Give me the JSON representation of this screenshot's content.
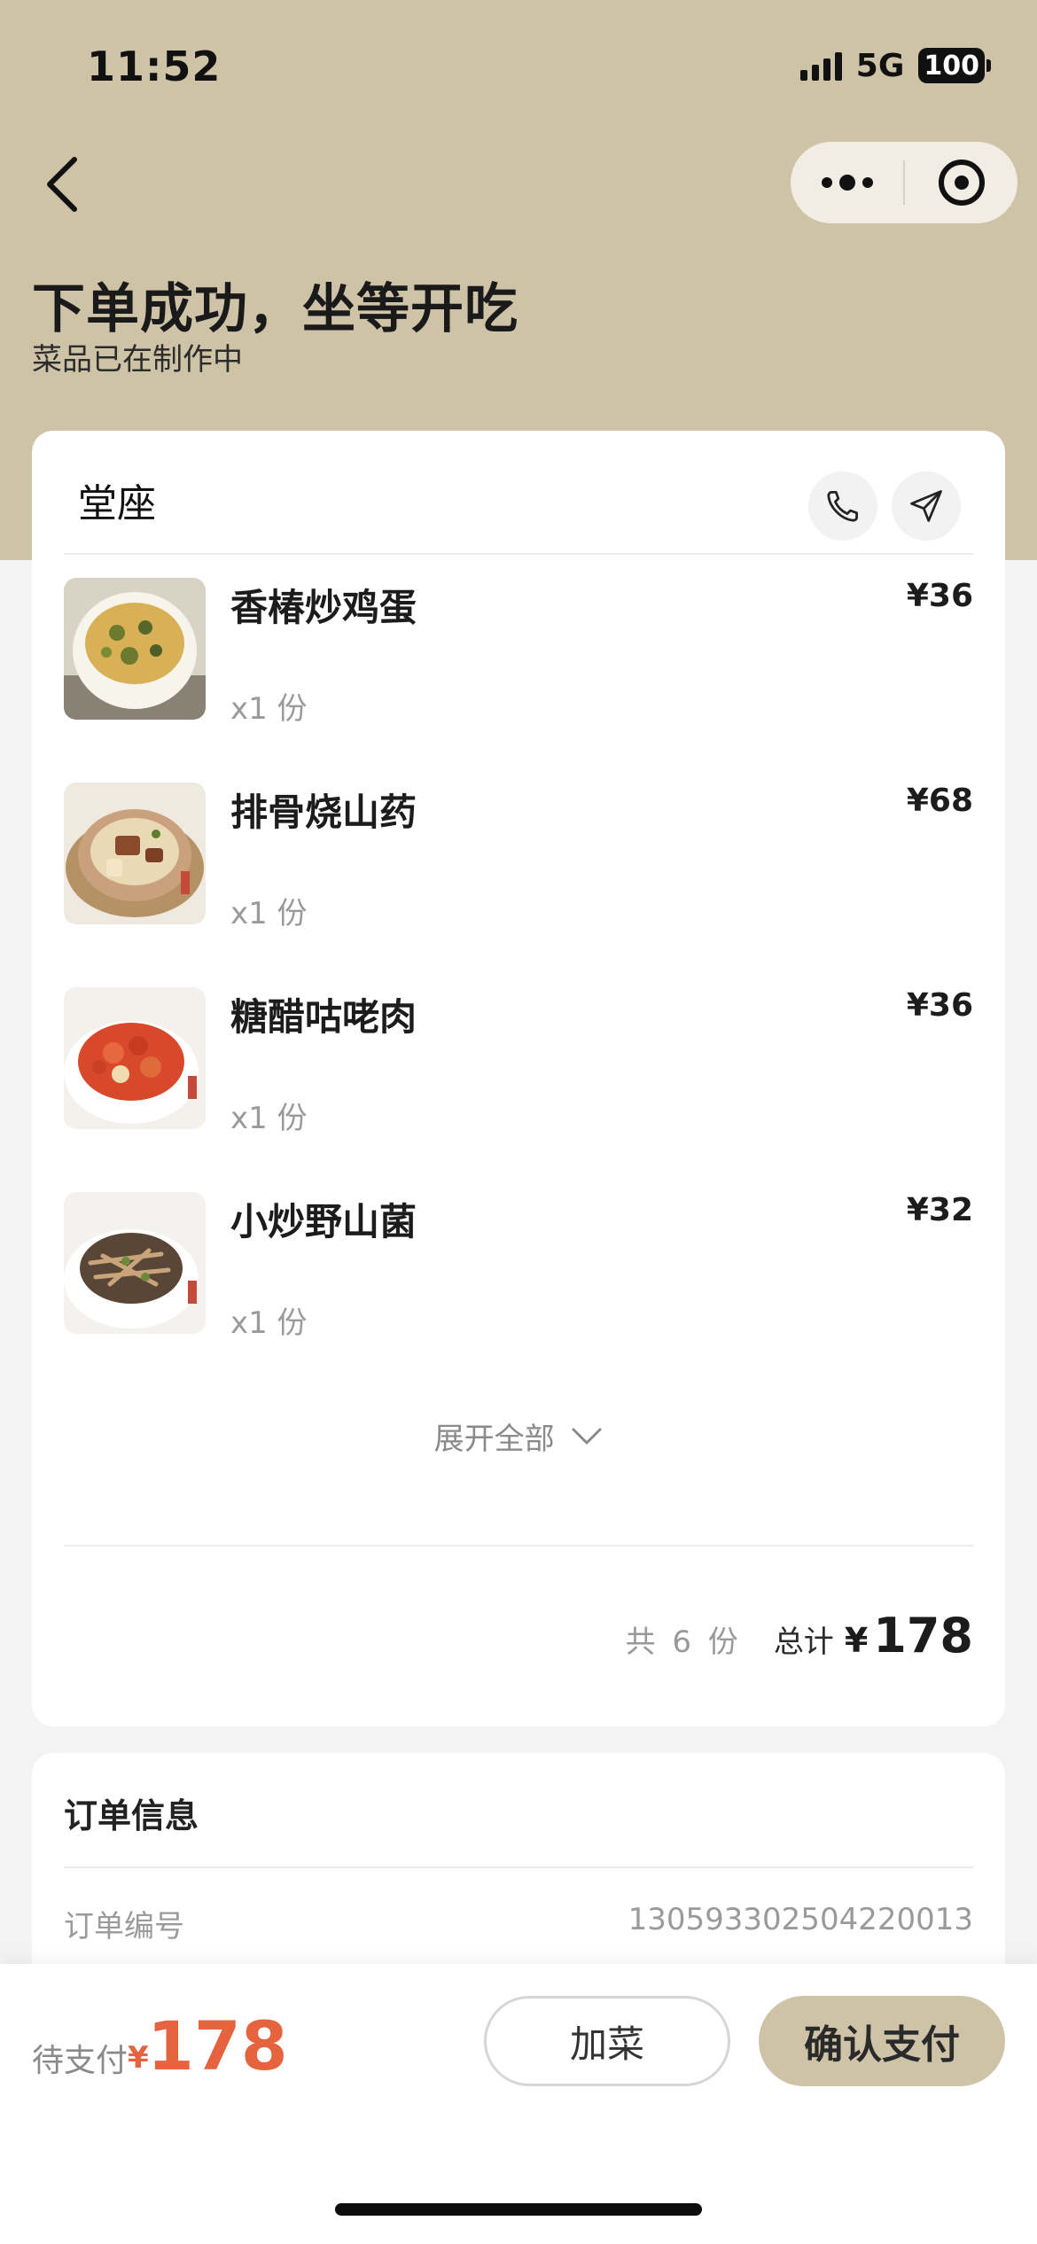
{
  "status_bar": {
    "time": "11:52",
    "network": "5G",
    "battery": "100"
  },
  "header": {
    "title": "下单成功，坐等开吃",
    "subtitle": "菜品已在制作中"
  },
  "order_card": {
    "title": "堂座",
    "items": [
      {
        "name": "香椿炒鸡蛋",
        "qty": "x1 份",
        "price": "¥36"
      },
      {
        "name": "排骨烧山药",
        "qty": "x1 份",
        "price": "¥68"
      },
      {
        "name": "糖醋咕咾肉",
        "qty": "x1 份",
        "price": "¥36"
      },
      {
        "name": "小炒野山菌",
        "qty": "x1 份",
        "price": "¥32"
      }
    ],
    "expand_label": "展开全部",
    "summary": {
      "count": "共 6 份",
      "total_label": "总计",
      "currency": "¥",
      "total": "178"
    }
  },
  "order_info": {
    "title": "订单信息",
    "order_number_label": "订单编号",
    "order_number": "1305933025042200​13"
  },
  "bottom_bar": {
    "pending_label": "待支付",
    "currency": "¥",
    "amount": "178",
    "add_button": "加菜",
    "confirm_button": "确认支付"
  },
  "icons": [
    "back-icon",
    "more-icon",
    "target-icon",
    "phone-icon",
    "navigation-icon",
    "chevron-down-icon"
  ],
  "colors": {
    "header_bg": "#cfc3a7",
    "accent_price": "#e5633f",
    "confirm_button": "#cfc3a7"
  }
}
